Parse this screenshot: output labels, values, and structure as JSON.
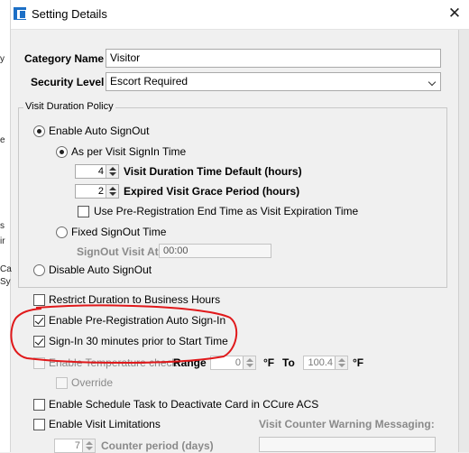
{
  "window": {
    "title": "Setting Details",
    "close_glyph": "✕"
  },
  "background_fragments": [
    "y",
    "e",
    "s",
    "ir",
    "Ca",
    "Sy"
  ],
  "category_name": {
    "label": "Category Name",
    "value": "Visitor"
  },
  "security_level": {
    "label": "Security Level",
    "value": "Escort Required"
  },
  "visit_duration_policy": {
    "title": "Visit Duration Policy",
    "enable_auto_signout": {
      "label": "Enable Auto SignOut",
      "selected": true
    },
    "as_per_signin": {
      "label": "As per Visit SignIn Time",
      "selected": true
    },
    "duration_default": {
      "value": "4",
      "label": "Visit Duration Time Default (hours)"
    },
    "grace_period": {
      "value": "2",
      "label": "Expired Visit Grace Period (hours)"
    },
    "use_prereg_end": {
      "label": "Use Pre-Registration End Time as Visit Expiration Time",
      "checked": false
    },
    "fixed_signout": {
      "label": "Fixed SignOut Time",
      "selected": false
    },
    "signout_visit_at": {
      "label": "SignOut Visit At:",
      "value": "00:00"
    },
    "disable_auto_signout": {
      "label": "Disable Auto SignOut",
      "selected": false
    }
  },
  "options": {
    "restrict_duration": {
      "label": "Restrict Duration to Business Hours",
      "checked": false
    },
    "enable_prereg_autosignin": {
      "label": "Enable Pre-Registration Auto Sign-In",
      "checked": true
    },
    "signin_prior": {
      "label": "Sign-In 30 minutes prior to Start Time",
      "checked": true
    },
    "temperature_check": {
      "label": "Enable Temperature check:",
      "checked": false,
      "range_label": "Range",
      "min": "0",
      "min_unit": "°F",
      "to_label": "To",
      "max": "100.4",
      "max_unit": "°F"
    },
    "override": {
      "label": "Override",
      "checked": false
    },
    "schedule_task": {
      "label": "Enable Schedule Task to Deactivate Card in CCure ACS",
      "checked": false
    },
    "visit_limitations": {
      "label": "Enable Visit Limitations",
      "checked": false
    },
    "counter_period": {
      "value": "7",
      "label": "Counter period (days)"
    },
    "warning_messaging": {
      "label": "Visit Counter Warning Messaging:"
    }
  },
  "colors": {
    "annotation": "#e0191b",
    "app_icon": "#1c6fc6"
  }
}
